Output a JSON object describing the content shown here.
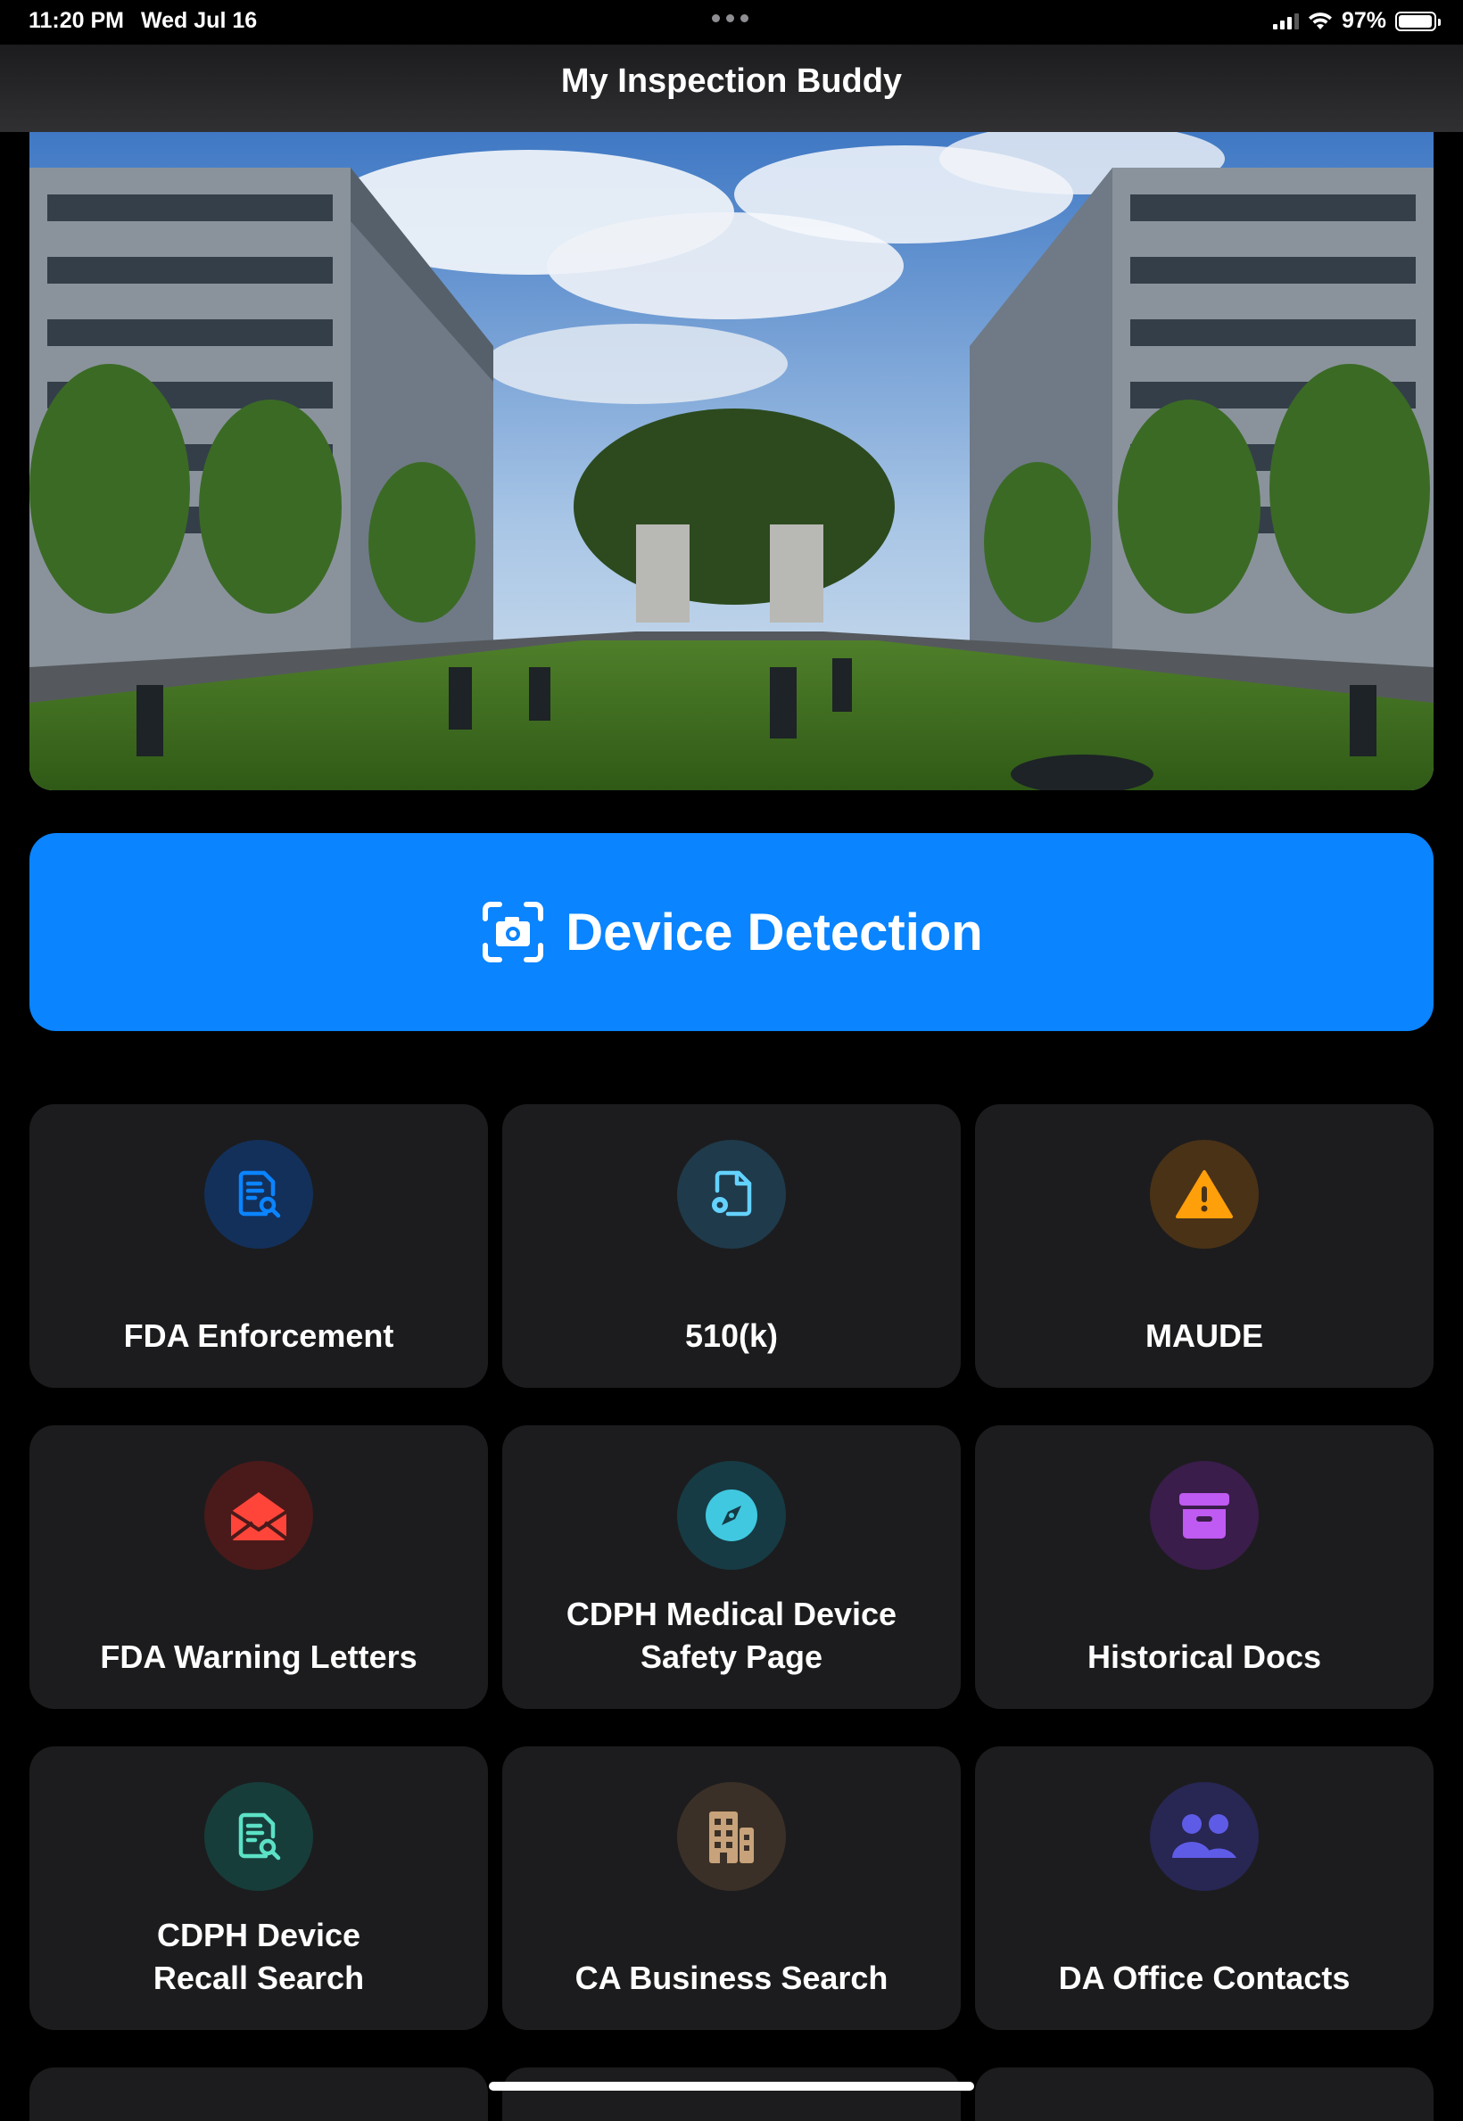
{
  "status_bar": {
    "time": "11:20 PM",
    "date": "Wed Jul 16",
    "battery": "97%",
    "battery_level": 0.97,
    "icons": [
      "signal-icon",
      "wifi-icon",
      "battery-icon"
    ]
  },
  "nav": {
    "title": "My Inspection Buddy"
  },
  "hero": {
    "image": "campus-buildings-photo"
  },
  "primary_action": {
    "label": "Device Detection",
    "icon": "camera-scan-icon",
    "color": "#0a84ff"
  },
  "tiles": [
    {
      "label": "FDA Enforcement",
      "icon": "document-search-icon",
      "icon_color": "#0a84ff",
      "bg_color": "#13305a"
    },
    {
      "label": "510(k)",
      "icon": "document-gear-icon",
      "icon_color": "#64d2ff",
      "bg_color": "#1f3a4a"
    },
    {
      "label": "MAUDE",
      "icon": "warning-icon",
      "icon_color": "#ff9f0a",
      "bg_color": "#4a3217"
    },
    {
      "label": "FDA Warning Letters",
      "icon": "envelope-open-icon",
      "icon_color": "#ff453a",
      "bg_color": "#4a1a1a"
    },
    {
      "label": "CDPH Medical Device\nSafety Page",
      "icon": "compass-icon",
      "icon_color": "#40c8e0",
      "bg_color": "#163b44"
    },
    {
      "label": "Historical Docs",
      "icon": "archive-box-icon",
      "icon_color": "#bf5af2",
      "bg_color": "#3a1d4a"
    },
    {
      "label": "CDPH Device\nRecall Search",
      "icon": "document-search-icon",
      "icon_color": "#5ce1c6",
      "bg_color": "#173d3a"
    },
    {
      "label": "CA Business Search",
      "icon": "building-icon",
      "icon_color": "#c7a27a",
      "bg_color": "#3b3027"
    },
    {
      "label": "DA Office Contacts",
      "icon": "people-icon",
      "icon_color": "#5e5ce6",
      "bg_color": "#282653"
    }
  ]
}
